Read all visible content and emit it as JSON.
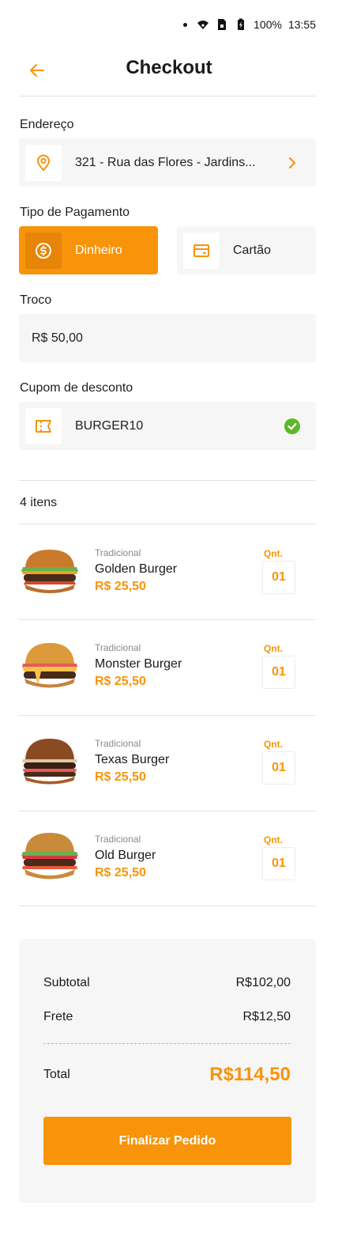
{
  "status_bar": {
    "battery": "100%",
    "time": "13:55"
  },
  "header": {
    "title": "Checkout"
  },
  "address": {
    "label": "Endereço",
    "value": "321 - Rua das Flores - Jardins..."
  },
  "payment": {
    "label": "Tipo de Pagamento",
    "options": [
      {
        "label": "Dinheiro",
        "selected": true
      },
      {
        "label": "Cartão",
        "selected": false
      }
    ]
  },
  "change": {
    "label": "Troco",
    "value": "R$ 50,00"
  },
  "coupon": {
    "label": "Cupom de desconto",
    "code": "BURGER10",
    "valid": true
  },
  "items_count": "4 itens",
  "qnt_label": "Qnt.",
  "items": [
    {
      "category": "Tradicional",
      "name": "Golden Burger",
      "price": "R$ 25,50",
      "qty": "01"
    },
    {
      "category": "Tradicional",
      "name": "Monster Burger",
      "price": "R$ 25,50",
      "qty": "01"
    },
    {
      "category": "Tradicional",
      "name": "Texas Burger",
      "price": "R$ 25,50",
      "qty": "01"
    },
    {
      "category": "Tradicional",
      "name": "Old Burger",
      "price": "R$ 25,50",
      "qty": "01"
    }
  ],
  "summary": {
    "subtotal_label": "Subtotal",
    "subtotal": "R$102,00",
    "shipping_label": "Frete",
    "shipping": "R$12,50",
    "total_label": "Total",
    "total": "R$114,50",
    "button": "Finalizar Pedido"
  },
  "colors": {
    "accent": "#f7940a",
    "field_bg": "#f6f6f7",
    "success": "#5cb82a"
  }
}
